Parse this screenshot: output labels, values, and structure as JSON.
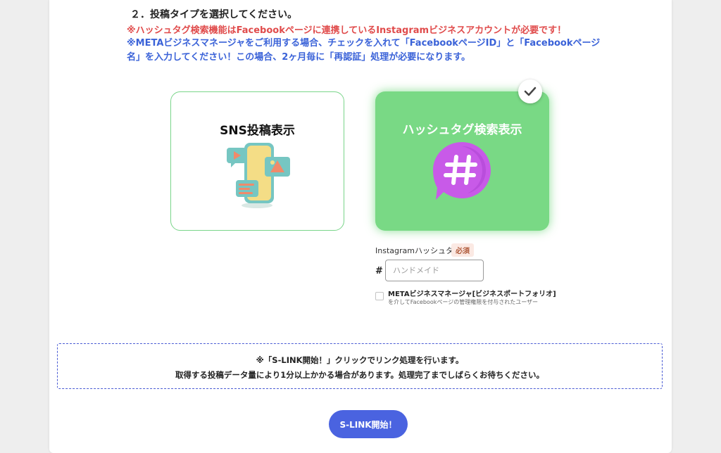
{
  "step": {
    "title": "２．投稿タイプを選択してください。",
    "note_red": "※ハッシュタグ検索機能はFacebookページに連携しているInstagramビジネスアカウントが必要です！",
    "note_blue": "※METAビジネスマネージャをご利用する場合、チェックを入れて「FacebookページID」と「Facebookページ名」を入力してください！この場合、2ヶ月毎に「再認証」処理が必要になります。"
  },
  "cards": {
    "sns": {
      "title": "SNS投稿表示",
      "icon": "phone-social-icon",
      "selected": false
    },
    "hashtag": {
      "title": "ハッシュタグ検索表示",
      "icon": "hashtag-bubble-icon",
      "selected": true
    }
  },
  "colors": {
    "selected_card": "#79d985",
    "card_border": "#7ad58a",
    "note_red": "#e04b4b",
    "note_blue": "#3a62d8",
    "primary_button": "#4a63e0",
    "hashtag_bubble": "#c85ae8"
  },
  "form": {
    "label": "Instagramハッシュタグ",
    "required": "必須",
    "prefix": "#",
    "placeholder": "ハンドメイド",
    "value": "",
    "meta_checkbox": {
      "checked": false,
      "title": "METAビジネスマネージャ[ビジネスポートフォリオ]",
      "subtitle": "を介してFacebookページの管理権限を付与されたユーザー"
    }
  },
  "info": {
    "line1": "※「S-LINK開始！」クリックでリンク処理を行います。",
    "line2": "取得する投稿データ量により1分以上かかる場合があります。処理完了までしばらくお待ちください。"
  },
  "action": {
    "start_label": "S-LINK開始！"
  }
}
